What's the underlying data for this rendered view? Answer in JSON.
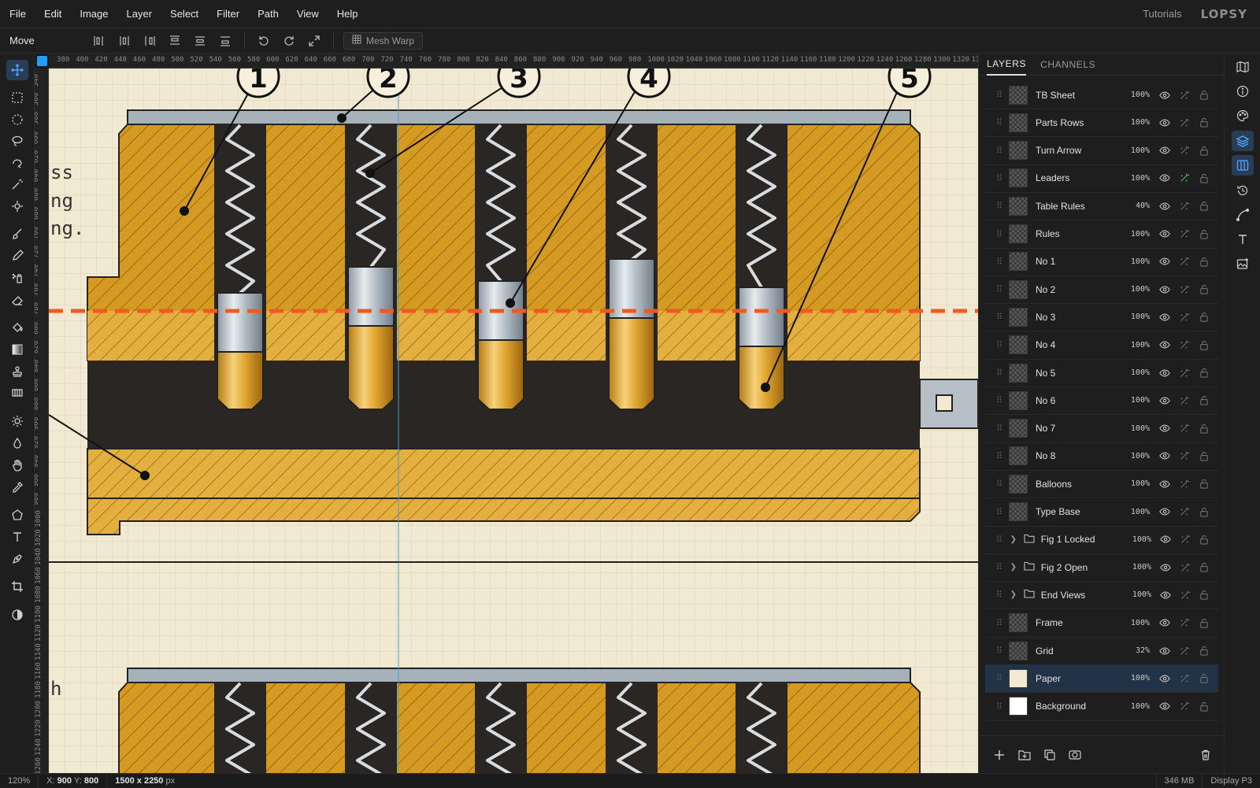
{
  "menu": [
    "File",
    "Edit",
    "Image",
    "Layer",
    "Select",
    "Filter",
    "Path",
    "View",
    "Help"
  ],
  "menu_right": {
    "tutorials": "Tutorials",
    "logo": "LOPSY"
  },
  "options": {
    "tool_name": "Move",
    "mesh_warp": "Mesh Warp"
  },
  "ruler": {
    "h": [
      "380",
      "400",
      "420",
      "440",
      "460",
      "480",
      "500",
      "520",
      "540",
      "560",
      "580",
      "600",
      "620",
      "640",
      "660",
      "680",
      "700",
      "720",
      "740",
      "760",
      "780",
      "800",
      "820",
      "840",
      "860",
      "880",
      "900",
      "920",
      "940",
      "960",
      "980",
      "1000",
      "1020",
      "1040",
      "1060",
      "1080",
      "1100",
      "1120",
      "1140",
      "1160",
      "1180",
      "1200",
      "1220",
      "1240",
      "1260",
      "1280",
      "1300",
      "1320",
      "13"
    ],
    "v": [
      "540",
      "560",
      "580",
      "600",
      "620",
      "640",
      "660",
      "680",
      "700",
      "720",
      "740",
      "760",
      "780",
      "800",
      "820",
      "840",
      "860",
      "880",
      "900",
      "920",
      "940",
      "960",
      "980",
      "1000",
      "1020",
      "1040",
      "1060",
      "1080",
      "1100",
      "1120",
      "1140",
      "1160",
      "1180",
      "1200",
      "1220",
      "1240",
      "1260"
    ]
  },
  "canvas_text": {
    "frag1": "ss",
    "frag2": "ng",
    "frag3": "ng.",
    "frag4": "h",
    "balloons": [
      "1",
      "2",
      "3",
      "4",
      "5"
    ]
  },
  "panel": {
    "tabs": [
      "LAYERS",
      "CHANNELS"
    ],
    "layers": [
      {
        "name": "TB Sheet",
        "opacity": "100%",
        "kind": "layer"
      },
      {
        "name": "Parts Rows",
        "opacity": "100%",
        "kind": "layer"
      },
      {
        "name": "Turn Arrow",
        "opacity": "100%",
        "kind": "layer"
      },
      {
        "name": "Leaders",
        "opacity": "100%",
        "kind": "layer",
        "fx_active": true
      },
      {
        "name": "Table Rules",
        "opacity": "40%",
        "kind": "layer"
      },
      {
        "name": "Rules",
        "opacity": "100%",
        "kind": "layer"
      },
      {
        "name": "No 1",
        "opacity": "100%",
        "kind": "layer"
      },
      {
        "name": "No 2",
        "opacity": "100%",
        "kind": "layer"
      },
      {
        "name": "No 3",
        "opacity": "100%",
        "kind": "layer"
      },
      {
        "name": "No 4",
        "opacity": "100%",
        "kind": "layer"
      },
      {
        "name": "No 5",
        "opacity": "100%",
        "kind": "layer"
      },
      {
        "name": "No 6",
        "opacity": "100%",
        "kind": "layer"
      },
      {
        "name": "No 7",
        "opacity": "100%",
        "kind": "layer"
      },
      {
        "name": "No 8",
        "opacity": "100%",
        "kind": "layer"
      },
      {
        "name": "Balloons",
        "opacity": "100%",
        "kind": "layer"
      },
      {
        "name": "Type Base",
        "opacity": "100%",
        "kind": "layer"
      },
      {
        "name": "Fig 1 Locked",
        "opacity": "100%",
        "kind": "group"
      },
      {
        "name": "Fig 2 Open",
        "opacity": "100%",
        "kind": "group"
      },
      {
        "name": "End Views",
        "opacity": "100%",
        "kind": "group"
      },
      {
        "name": "Frame",
        "opacity": "100%",
        "kind": "layer"
      },
      {
        "name": "Grid",
        "opacity": "32%",
        "kind": "layer"
      },
      {
        "name": "Paper",
        "opacity": "100%",
        "kind": "layer",
        "selected": true
      },
      {
        "name": "Background",
        "opacity": "100%",
        "kind": "layer"
      }
    ]
  },
  "status": {
    "zoom": "120%",
    "x_label": "X:",
    "x": "900",
    "y_label": "Y:",
    "y": "800",
    "size": "1500 x 2250",
    "size_unit": "px",
    "memory": "346 MB",
    "profile": "Display P3"
  },
  "colors": {
    "accent": "#4ea8ff",
    "brass": "#d9a02a",
    "paper": "#f1e9d2",
    "shear_line": "#ee5a1f"
  }
}
